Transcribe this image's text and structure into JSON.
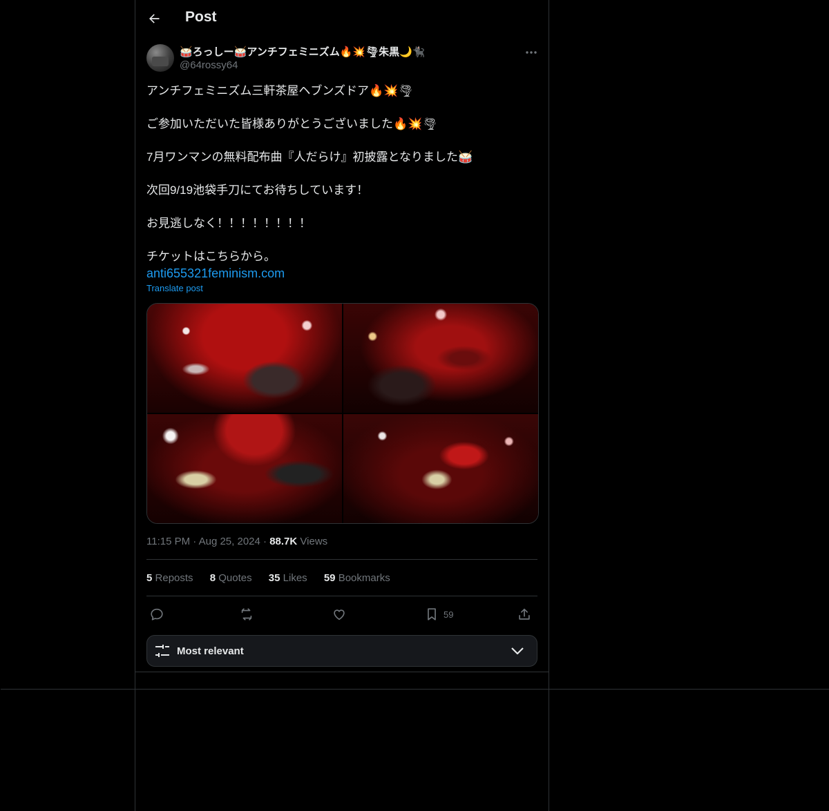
{
  "header": {
    "title": "Post"
  },
  "author": {
    "display_name": "🥁ろっしー🥁アンチフェミニズム🔥💥🌪朱黒🌙🐈‍⬛",
    "handle": "@64rossy64"
  },
  "post": {
    "lines": [
      "アンチフェミニズム三軒茶屋ヘブンズドア🔥💥🌪",
      "ご参加いただいた皆様ありがとうございました🔥💥🌪",
      "7月ワンマンの無料配布曲『人だらけ』初披露となりました🥁",
      "次回9/19池袋手刀にてお待ちしています！",
      "お見逃しなく！！！！！！！！",
      "チケットはこちらから。"
    ],
    "link": "anti655321feminism.com",
    "translate": "Translate post"
  },
  "meta": {
    "time": "11:15 PM",
    "date": "Aug 25, 2024",
    "views_count": "88.7K",
    "views_label": "Views"
  },
  "stats": {
    "reposts": {
      "count": "5",
      "label": "Reposts"
    },
    "quotes": {
      "count": "8",
      "label": "Quotes"
    },
    "likes": {
      "count": "35",
      "label": "Likes"
    },
    "bookmarks": {
      "count": "59",
      "label": "Bookmarks"
    }
  },
  "actions": {
    "bookmark_count": "59"
  },
  "sort": {
    "label": "Most relevant"
  },
  "colors": {
    "background": "#000000",
    "text": "#e7e9ea",
    "muted": "#71767b",
    "link": "#1d9bf0",
    "border": "#2f3336"
  }
}
